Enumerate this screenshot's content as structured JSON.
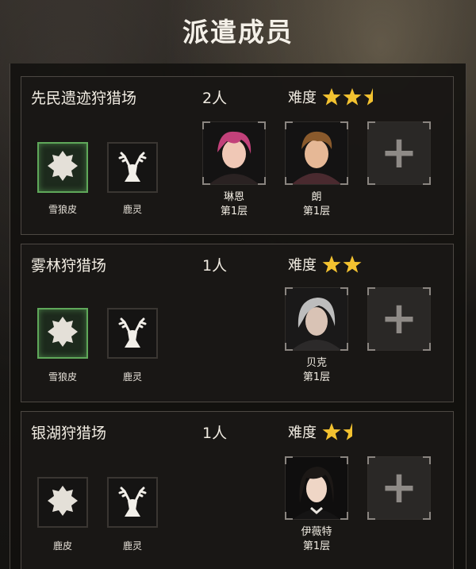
{
  "screen_title": "派遣成员",
  "cards": [
    {
      "name": "先民遗迹狩猎场",
      "count": "2人",
      "difficulty_label": "难度",
      "difficulty": 2.5,
      "rewards": [
        "雪狼皮",
        "鹿灵"
      ],
      "members": [
        {
          "name": "琳恩",
          "floor": "第1层",
          "hair": "#c2417a",
          "skin": "#f0c8b6"
        },
        {
          "name": "朗",
          "floor": "第1层",
          "hair": "#8a5a2c",
          "skin": "#e6b896"
        }
      ]
    },
    {
      "name": "雾林狩猎场",
      "count": "1人",
      "difficulty_label": "难度",
      "difficulty": 2,
      "rewards": [
        "雪狼皮",
        "鹿灵"
      ],
      "members": [
        {
          "name": "贝克",
          "floor": "第1层",
          "hair": "#bdbdbd",
          "skin": "#d9c3b5"
        }
      ]
    },
    {
      "name": "银湖狩猎场",
      "count": "1人",
      "difficulty_label": "难度",
      "difficulty": 1.5,
      "rewards": [
        "鹿皮",
        "鹿灵"
      ],
      "members": [
        {
          "name": "伊薇特",
          "floor": "第1层",
          "hair": "#1c1816",
          "skin": "#efd6c6"
        }
      ]
    }
  ],
  "colors": {
    "star": "#f3c230",
    "reward_highlight": "#5fa85a"
  },
  "icons": {
    "pelt": "pelt-icon",
    "deer": "deer-spirit-icon",
    "add": "plus-icon"
  }
}
